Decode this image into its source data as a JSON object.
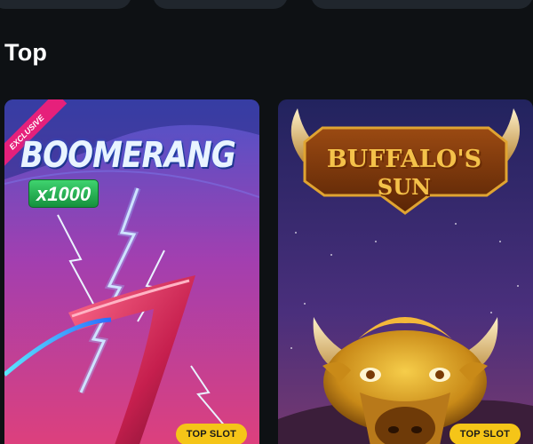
{
  "section": {
    "title": "Top"
  },
  "games": [
    {
      "name": "Boomerang",
      "logo_text": "BOOMERANG",
      "ribbon": "EXCLUSIVE",
      "multiplier": "x1000",
      "badge": "TOP SLOT"
    },
    {
      "name": "Buffalo's Sun",
      "logo_line1": "BUFFALO'S",
      "logo_line2": "SUN",
      "badge": "TOP SLOT"
    }
  ],
  "colors": {
    "background": "#0e1114",
    "pill": "#20262d",
    "badge": "#f5c518",
    "ribbon": "#e6207b"
  }
}
